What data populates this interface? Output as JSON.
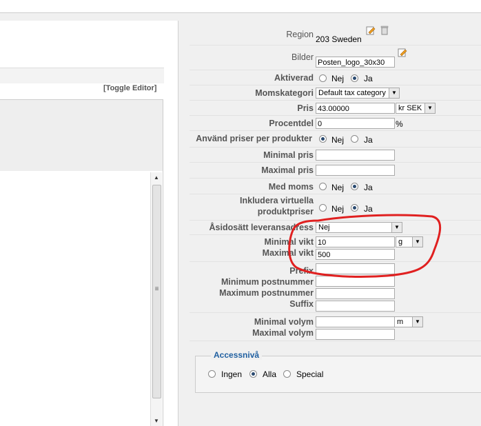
{
  "editor": {
    "toggle_label": "[Toggle Editor]"
  },
  "form": {
    "region": {
      "label": "Region",
      "value": "203 Sweden"
    },
    "bilder": {
      "label": "Bilder",
      "value": "Posten_logo_30x30"
    },
    "aktiverad": {
      "label": "Aktiverad",
      "options": [
        "Nej",
        "Ja"
      ],
      "selected": "Ja"
    },
    "momskategori": {
      "label": "Momskategori",
      "value": "Default tax category"
    },
    "pris": {
      "label": "Pris",
      "value": "43.00000",
      "currency": "kr SEK"
    },
    "procentdel": {
      "label": "Procentdel",
      "value": "0",
      "unit": "%"
    },
    "anvand_priser": {
      "label": "Använd priser per produkter",
      "options": [
        "Nej",
        "Ja"
      ],
      "selected": "Nej"
    },
    "minimal_pris": {
      "label": "Minimal pris",
      "value": ""
    },
    "maximal_pris": {
      "label": "Maximal pris",
      "value": ""
    },
    "med_moms": {
      "label": "Med moms",
      "options": [
        "Nej",
        "Ja"
      ],
      "selected": "Ja"
    },
    "inkludera": {
      "label_line1": "Inkludera virtuella",
      "label_line2": "produktpriser",
      "options": [
        "Nej",
        "Ja"
      ],
      "selected": "Ja"
    },
    "asidosatt": {
      "label": "Åsidosätt leveransadress",
      "value": "Nej"
    },
    "minimal_vikt": {
      "label": "Minimal vikt",
      "value": "10",
      "unit": "g"
    },
    "maximal_vikt": {
      "label": "Maximal vikt",
      "value": "500"
    },
    "prefix": {
      "label": "Prefix",
      "value": ""
    },
    "minimum_postnummer": {
      "label": "Minimum postnummer",
      "value": ""
    },
    "maximum_postnummer": {
      "label": "Maximum postnummer",
      "value": ""
    },
    "suffix": {
      "label": "Suffix",
      "value": ""
    },
    "minimal_volym": {
      "label": "Minimal volym",
      "value": "",
      "unit": "m"
    },
    "maximal_volym": {
      "label": "Maximal volym",
      "value": ""
    }
  },
  "accessniva": {
    "legend": "Accessnivå",
    "options": [
      "Ingen",
      "Alla",
      "Special"
    ],
    "selected": "Alla"
  },
  "colors": {
    "legend": "#1f5fa0",
    "annotation": "#e02020"
  }
}
